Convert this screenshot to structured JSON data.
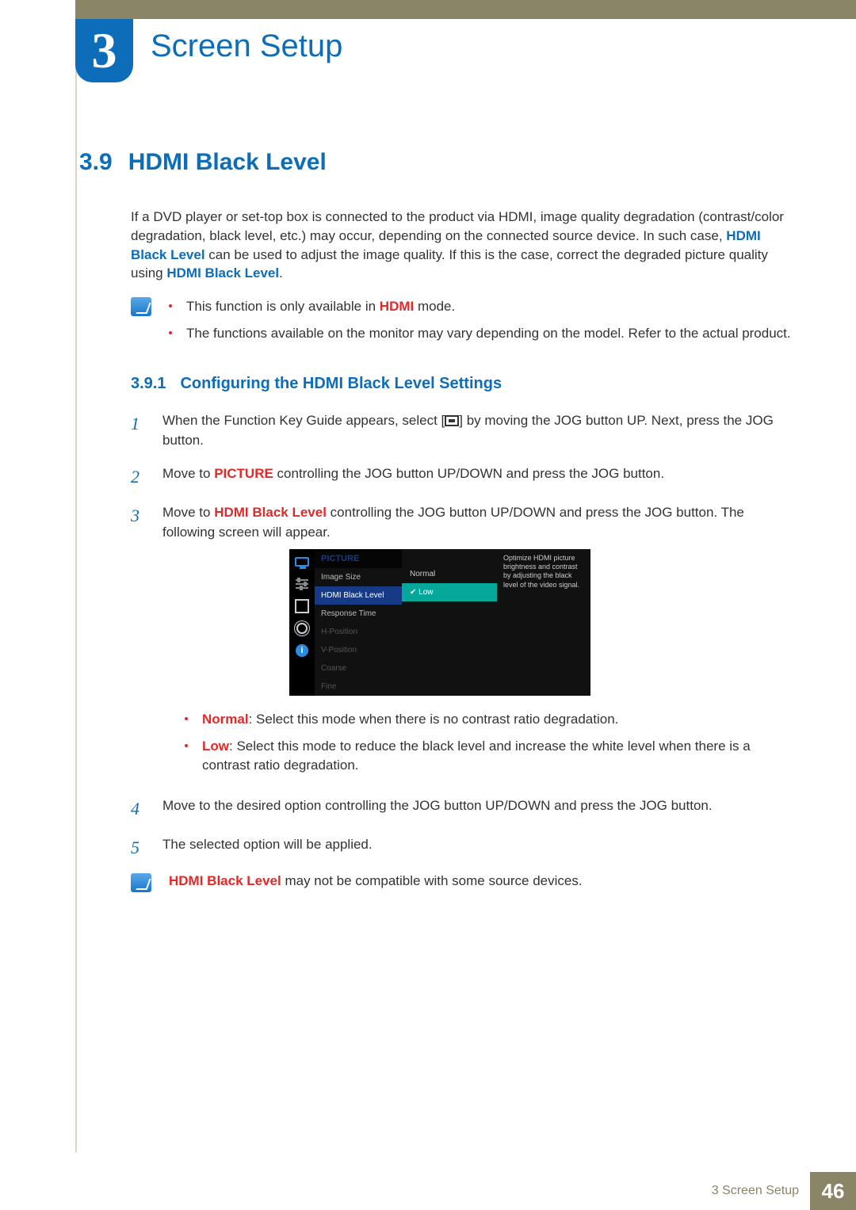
{
  "chapter": {
    "number": "3",
    "title": "Screen Setup"
  },
  "section": {
    "number": "3.9",
    "title": "HDMI Black Level"
  },
  "intro": {
    "p1a": "If a DVD player or set-top box is connected to the product via HDMI, image quality degradation (contrast/color degradation, black level, etc.) may occur, depending on the connected source device. In such case, ",
    "p1b": "HDMI Black Level",
    "p1c": " can be used to adjust the image quality. If this is the case, correct the degraded picture quality using ",
    "p1d": "HDMI Black Level",
    "p1e": "."
  },
  "note1": {
    "b1a": "This function is only available in ",
    "b1b": "HDMI",
    "b1c": " mode.",
    "b2": "The functions available on the monitor may vary depending on the model. Refer to the actual product."
  },
  "subsection": {
    "number": "3.9.1",
    "title": "Configuring the HDMI Black Level Settings"
  },
  "steps": {
    "s1a": "When the Function Key Guide appears, select [",
    "s1b": "] by moving the JOG button UP. Next, press the JOG button.",
    "s2a": "Move to ",
    "s2b": "PICTURE",
    "s2c": " controlling the JOG button UP/DOWN and press the JOG button.",
    "s3a": "Move to ",
    "s3b": "HDMI Black Level",
    "s3c": " controlling the JOG button UP/DOWN and press the JOG button. The following screen will appear.",
    "s4": "Move to the desired option controlling the JOG button UP/DOWN and press the JOG button.",
    "s5": "The selected option will be applied."
  },
  "osd": {
    "header": "PICTURE",
    "items": [
      "Image Size",
      "HDMI Black Level",
      "Response Time",
      "H-Position",
      "V-Position",
      "Coarse",
      "Fine"
    ],
    "options": [
      "Normal",
      "Low"
    ],
    "desc": "Optimize HDMI picture brightness and contrast by adjusting the black level of the video signal.",
    "info_glyph": "i"
  },
  "modes": {
    "m1lbl": "Normal",
    "m1txt": ": Select this mode when there is no contrast ratio degradation.",
    "m2lbl": "Low",
    "m2txt": ": Select this mode to reduce the black level and increase the white level when there is a contrast ratio degradation."
  },
  "note2": {
    "a": "HDMI Black Level",
    "b": " may not be compatible with some source devices."
  },
  "footer": {
    "text": "3 Screen Setup",
    "page": "46"
  }
}
